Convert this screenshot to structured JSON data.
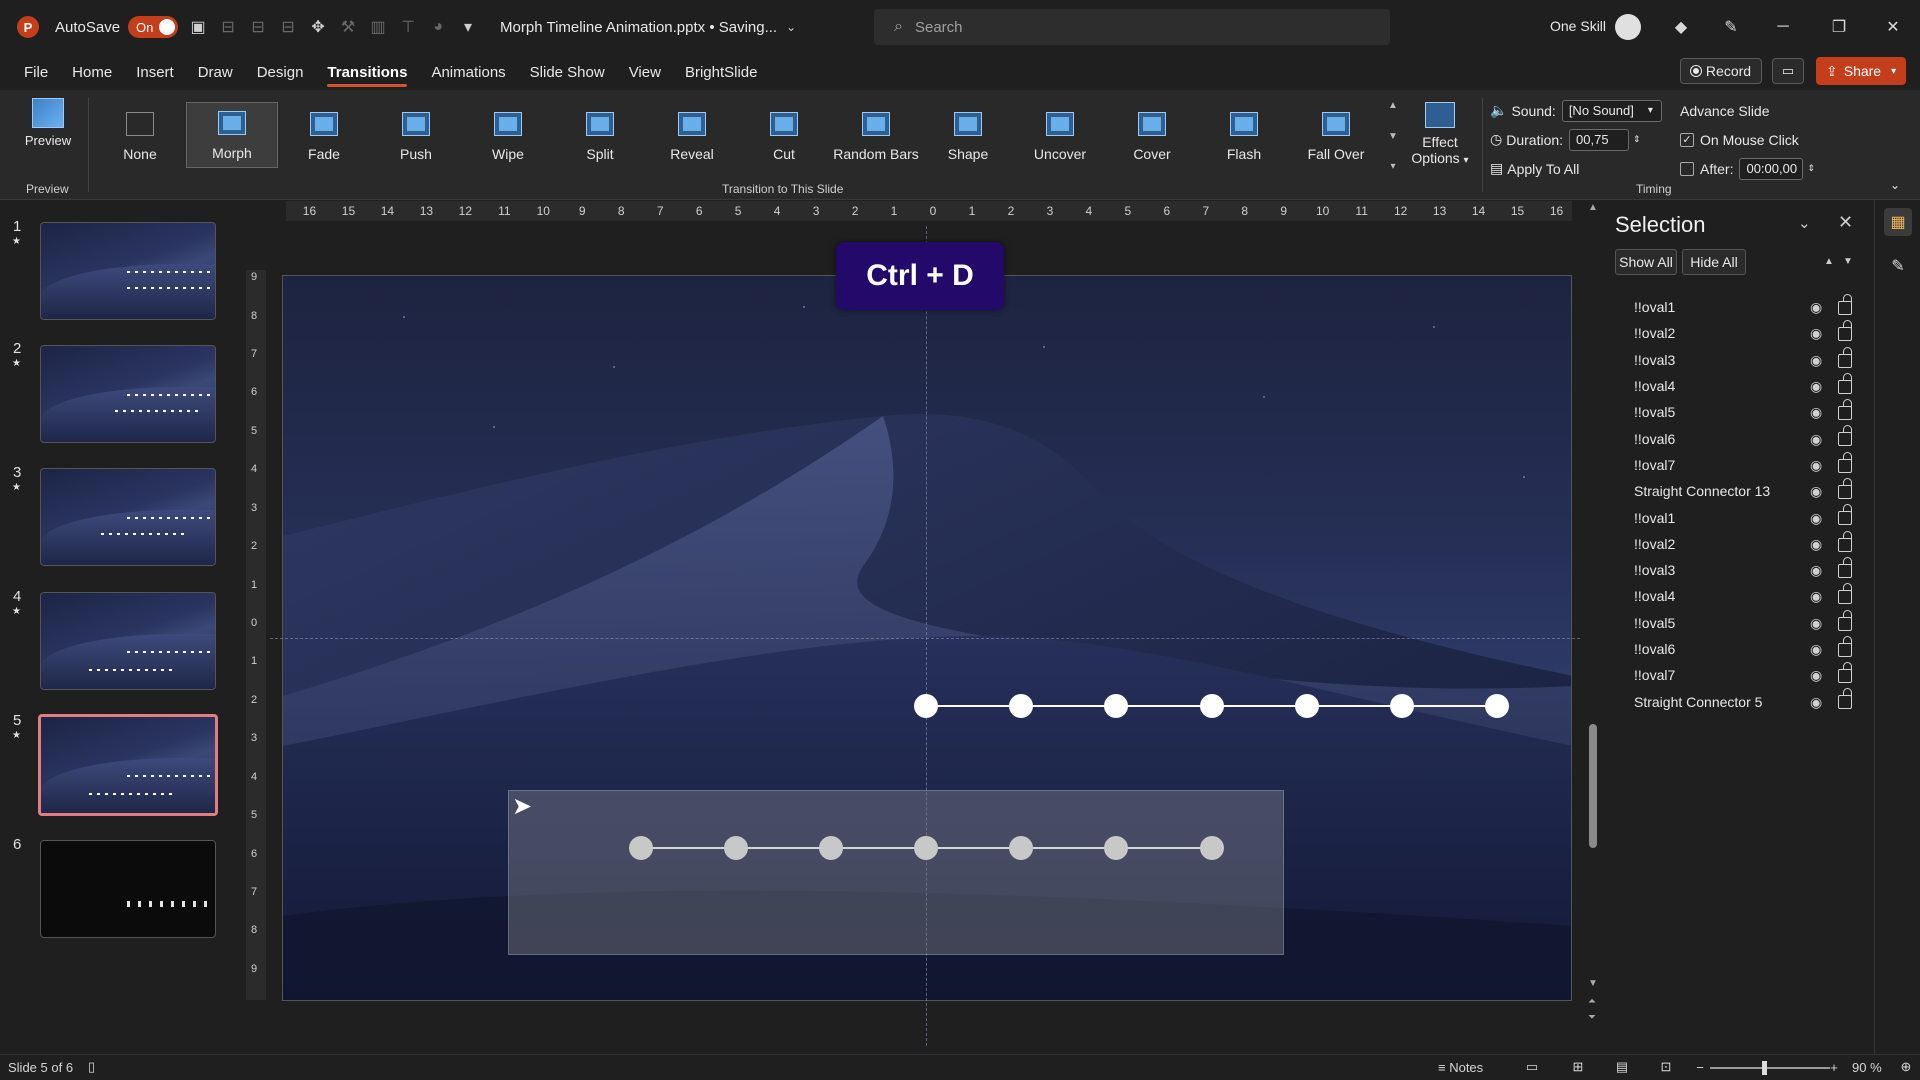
{
  "app": {
    "autosave_label": "AutoSave",
    "autosave_state": "On",
    "file_title": "Morph Timeline Animation.pptx • Saving...",
    "search_placeholder": "Search",
    "user_name": "One Skill",
    "brand_color": "#c43e1c"
  },
  "menu": {
    "items": [
      "File",
      "Home",
      "Insert",
      "Draw",
      "Design",
      "Transitions",
      "Animations",
      "Slide Show",
      "View",
      "BrightSlide"
    ],
    "active": "Transitions",
    "record_label": "Record",
    "share_label": "Share"
  },
  "ribbon": {
    "preview_label": "Preview",
    "preview_group": "Preview",
    "transitions_group": "Transition to This Slide",
    "transitions": [
      "None",
      "Morph",
      "Fade",
      "Push",
      "Wipe",
      "Split",
      "Reveal",
      "Cut",
      "Random Bars",
      "Shape",
      "Uncover",
      "Cover",
      "Flash",
      "Fall Over"
    ],
    "selected_transition": "Morph",
    "effect_options_label": "Effect Options",
    "sound_label": "Sound:",
    "sound_value": "[No Sound]",
    "duration_label": "Duration:",
    "duration_value": "00,75",
    "apply_to_all_label": "Apply To All",
    "advance_slide_label": "Advance Slide",
    "on_mouse_click_label": "On Mouse Click",
    "on_mouse_click_checked": true,
    "after_label": "After:",
    "after_value": "00:00,00",
    "after_checked": false,
    "timing_group": "Timing"
  },
  "thumbnails": {
    "slides": [
      {
        "number": "1",
        "star": "★"
      },
      {
        "number": "2",
        "star": "★"
      },
      {
        "number": "3",
        "star": "★"
      },
      {
        "number": "4",
        "star": "★"
      },
      {
        "number": "5",
        "star": "★"
      },
      {
        "number": "6",
        "star": ""
      }
    ],
    "selected": 5
  },
  "ruler": {
    "horizontal": [
      "16",
      "15",
      "14",
      "13",
      "12",
      "11",
      "10",
      "9",
      "8",
      "7",
      "6",
      "5",
      "4",
      "3",
      "2",
      "1",
      "0",
      "1",
      "2",
      "3",
      "4",
      "5",
      "6",
      "7",
      "8",
      "9",
      "10",
      "11",
      "12",
      "13",
      "14",
      "15",
      "16"
    ],
    "vertical": [
      "9",
      "8",
      "7",
      "6",
      "5",
      "4",
      "3",
      "2",
      "1",
      "0",
      "1",
      "2",
      "3",
      "4",
      "5",
      "6",
      "7",
      "8",
      "9"
    ]
  },
  "slide": {
    "shortcut_text": "Ctrl + D",
    "shortcut_color": "#230a6a",
    "timeline_top_dots": 7,
    "timeline_bottom_dots": 7
  },
  "selection_pane": {
    "title": "Selection",
    "show_all_label": "Show All",
    "hide_all_label": "Hide All",
    "items": [
      "!!oval1",
      "!!oval2",
      "!!oval3",
      "!!oval4",
      "!!oval5",
      "!!oval6",
      "!!oval7",
      "Straight Connector 13",
      "!!oval1",
      "!!oval2",
      "!!oval3",
      "!!oval4",
      "!!oval5",
      "!!oval6",
      "!!oval7",
      "Straight Connector 5"
    ]
  },
  "status": {
    "slide_info": "Slide 5 of 6",
    "notes_label": "Notes",
    "zoom": "90 %"
  }
}
